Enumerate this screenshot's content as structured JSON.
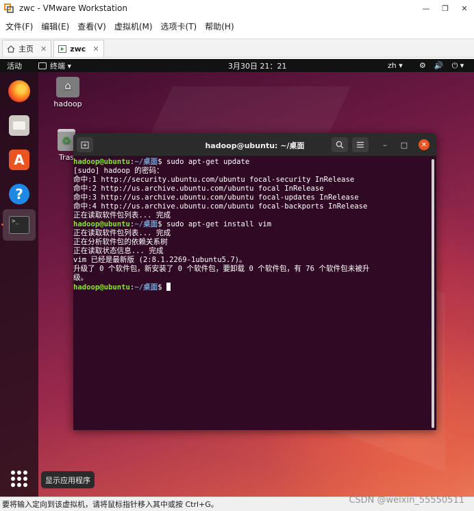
{
  "window": {
    "title": "zwc - VMware Workstation",
    "controls": [
      "—",
      "❐",
      "✕"
    ]
  },
  "menubar": [
    "文件(F)",
    "编辑(E)",
    "查看(V)",
    "虚拟机(M)",
    "选项卡(T)",
    "帮助(H)"
  ],
  "tabs": [
    {
      "label": "主页",
      "close": "✕"
    },
    {
      "label": "zwc",
      "close": "✕"
    }
  ],
  "topbar": {
    "activities": "活动",
    "app_menu": "终端 ▾",
    "clock": "3月30日  21：21",
    "lang": "zh ▾",
    "system_icons": [
      "⚙",
      "🔊",
      "⏻ ▾"
    ]
  },
  "dock": {
    "store_glyph": "A",
    "help_glyph": "?",
    "terminal_glyph": ">_"
  },
  "desktop": {
    "home_label": "hadoop",
    "trash_label": "Tras"
  },
  "terminal": {
    "title": "hadoop@ubuntu: ~/桌面",
    "prompt_user": "hadoop@ubuntu",
    "prompt_sep": ":",
    "prompt_path": "~/桌面",
    "prompt_end": "$ ",
    "lines": [
      {
        "prompt": true,
        "text": "sudo apt-get update"
      },
      {
        "prompt": false,
        "text": "[sudo] hadoop 的密码："
      },
      {
        "prompt": false,
        "text": "命中:1 http://security.ubuntu.com/ubuntu focal-security InRelease"
      },
      {
        "prompt": false,
        "text": "命中:2 http://us.archive.ubuntu.com/ubuntu focal InRelease"
      },
      {
        "prompt": false,
        "text": "命中:3 http://us.archive.ubuntu.com/ubuntu focal-updates InRelease"
      },
      {
        "prompt": false,
        "text": "命中:4 http://us.archive.ubuntu.com/ubuntu focal-backports InRelease"
      },
      {
        "prompt": false,
        "text": "正在读取软件包列表... 完成"
      },
      {
        "prompt": true,
        "text": "sudo apt-get install vim"
      },
      {
        "prompt": false,
        "text": "正在读取软件包列表... 完成"
      },
      {
        "prompt": false,
        "text": "正在分析软件包的依赖关系树"
      },
      {
        "prompt": false,
        "text": "正在读取状态信息... 完成"
      },
      {
        "prompt": false,
        "text": "vim 已经是最新版 (2:8.1.2269-1ubuntu5.7)。"
      },
      {
        "prompt": false,
        "text": "升级了 0 个软件包，新安装了 0 个软件包，要卸载 0 个软件包，有 76 个软件包未被升"
      },
      {
        "prompt": false,
        "text": "级。"
      },
      {
        "prompt": true,
        "text": "",
        "cursor": true
      }
    ]
  },
  "show_apps_tooltip": "显示应用程序",
  "statusbar": {
    "text": "要将输入定向到该虚拟机，请将鼠标指针移入其中或按 Ctrl+G。"
  },
  "watermark": "CSDN @weixin_55550511"
}
